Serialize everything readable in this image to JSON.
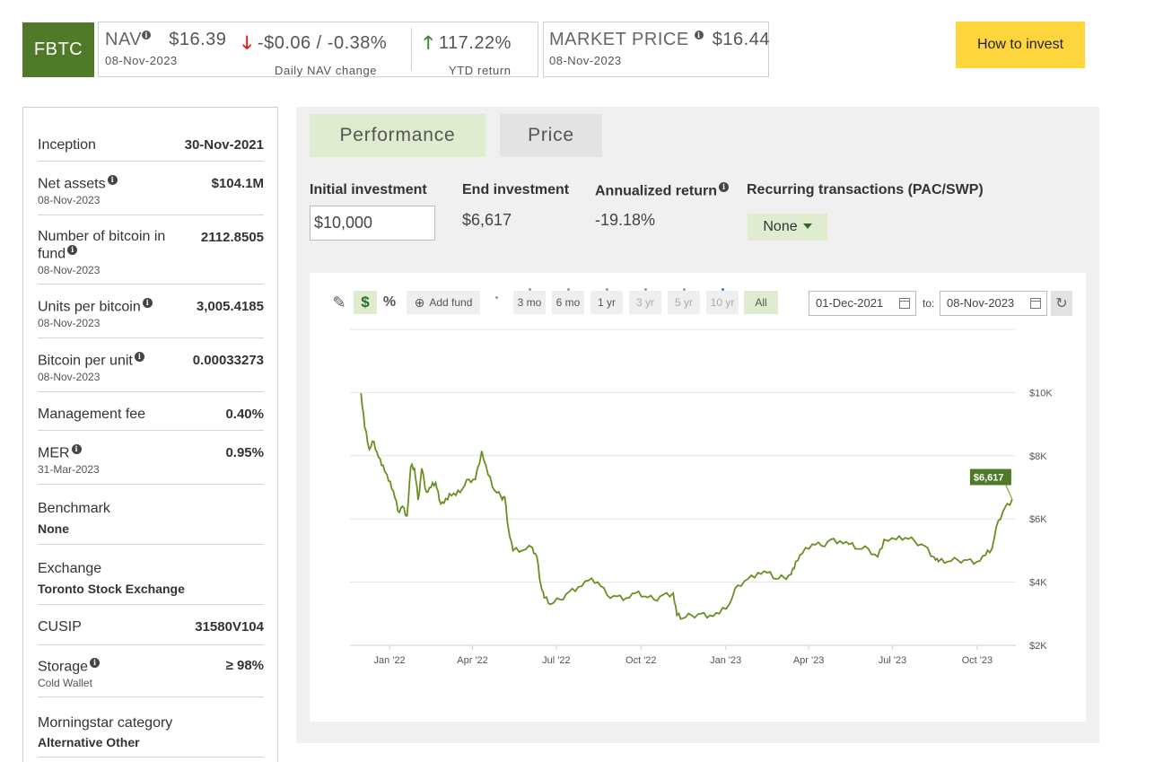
{
  "header": {
    "ticker": "FBTC",
    "nav_label": "NAV",
    "nav_value": "$16.39",
    "nav_date": "08-Nov-2023",
    "daily_change": "-$0.06 / -0.38%",
    "daily_change_label": "Daily NAV change",
    "ytd_return": "117.22%",
    "ytd_label": "YTD return",
    "market_price_label": "MARKET PRICE",
    "market_price_value": "$16.44",
    "market_price_date": "08-Nov-2023",
    "invest_button": "How to invest",
    "arrow_down": "🡓",
    "arrow_up": "🡑",
    "info_glyph": "i"
  },
  "facts": [
    {
      "label": "Inception",
      "value": "30-Nov-2021"
    },
    {
      "label": "Net assets",
      "value": "$104.1M",
      "sub": "08-Nov-2023"
    },
    {
      "label": "Number of bitcoin in fund",
      "value": "2112.8505",
      "sub": "08-Nov-2023"
    },
    {
      "label": "Units per bitcoin",
      "value": "3,005.4185",
      "sub": "08-Nov-2023"
    },
    {
      "label": "Bitcoin per unit",
      "value": "0.00033273",
      "sub": "08-Nov-2023"
    },
    {
      "label": "Management fee",
      "value": "0.40%"
    },
    {
      "label": "MER",
      "value": "0.95%",
      "sub": "31-Mar-2023"
    },
    {
      "label": "Benchmark",
      "subbold": "None"
    },
    {
      "label": "Exchange",
      "subbold": "Toronto Stock Exchange"
    },
    {
      "label": "CUSIP",
      "value": "31580V104"
    },
    {
      "label": "Storage",
      "value": "≥ 98%",
      "sub": "Cold Wallet"
    },
    {
      "label": "Morningstar category",
      "subbold": "Alternative Other"
    }
  ],
  "performance": {
    "tabs": [
      "Performance",
      "Price"
    ],
    "initial_investment_label": "Initial investment",
    "initial_investment_value": "$10,000",
    "end_investment_label": "End investment",
    "end_investment_value": "$6,617",
    "annualized_return_label": "Annualized return",
    "annualized_return_value": "-19.18%",
    "recurring_label": "Recurring transactions (PAC/SWP)",
    "recurring_value": "None",
    "toolbar": {
      "pencil_icon": "✎",
      "dollar": "$",
      "percent": "%",
      "add_fund": "Add fund",
      "add_icon": "⊕",
      "ranges": [
        "3 mo",
        "6 mo",
        "1 yr",
        "3 yr",
        "5 yr",
        "10 yr",
        "All"
      ],
      "from_date": "01-Dec-2021",
      "to_label": "to:",
      "to_date": "08-Nov-2023",
      "reset_icon": "↻"
    },
    "end_label": "$6,617"
  },
  "chart_data": {
    "type": "line",
    "title": "",
    "xlabel": "",
    "ylabel": "",
    "x_ticks": [
      "Jan '22",
      "Apr '22",
      "Jul '22",
      "Oct '22",
      "Jan '23",
      "Apr '23",
      "Jul '23",
      "Oct '23"
    ],
    "y_ticks": [
      "$2K",
      "$4K",
      "$6K",
      "$8K",
      "$10K"
    ],
    "ylim": [
      2000,
      12000
    ],
    "grid": true,
    "series": [
      {
        "color": "#6b8e23",
        "x": [
          "2021-12-01",
          "2021-12-05",
          "2021-12-10",
          "2021-12-15",
          "2021-12-20",
          "2021-12-25",
          "2021-12-31",
          "2022-01-05",
          "2022-01-10",
          "2022-01-15",
          "2022-01-20",
          "2022-01-24",
          "2022-01-28",
          "2022-02-01",
          "2022-02-05",
          "2022-02-10",
          "2022-02-15",
          "2022-02-20",
          "2022-02-24",
          "2022-03-01",
          "2022-03-07",
          "2022-03-14",
          "2022-03-21",
          "2022-03-28",
          "2022-04-04",
          "2022-04-11",
          "2022-04-18",
          "2022-04-25",
          "2022-05-02",
          "2022-05-06",
          "2022-05-10",
          "2022-05-15",
          "2022-05-25",
          "2022-06-05",
          "2022-06-10",
          "2022-06-14",
          "2022-06-18",
          "2022-06-25",
          "2022-07-05",
          "2022-07-15",
          "2022-07-25",
          "2022-08-05",
          "2022-08-15",
          "2022-08-25",
          "2022-09-05",
          "2022-09-15",
          "2022-09-25",
          "2022-10-05",
          "2022-10-15",
          "2022-10-25",
          "2022-11-05",
          "2022-11-09",
          "2022-11-15",
          "2022-11-25",
          "2022-12-05",
          "2022-12-15",
          "2022-12-25",
          "2023-01-05",
          "2023-01-14",
          "2023-01-25",
          "2023-02-05",
          "2023-02-15",
          "2023-02-25",
          "2023-03-05",
          "2023-03-13",
          "2023-03-18",
          "2023-03-25",
          "2023-04-05",
          "2023-04-15",
          "2023-04-25",
          "2023-05-05",
          "2023-05-15",
          "2023-05-25",
          "2023-06-05",
          "2023-06-15",
          "2023-06-22",
          "2023-07-05",
          "2023-07-15",
          "2023-07-25",
          "2023-08-05",
          "2023-08-15",
          "2023-08-20",
          "2023-08-30",
          "2023-09-10",
          "2023-09-20",
          "2023-10-01",
          "2023-10-10",
          "2023-10-17",
          "2023-10-24",
          "2023-10-31",
          "2023-11-08"
        ],
        "values": [
          9980,
          8900,
          8200,
          8450,
          7950,
          7700,
          7200,
          6900,
          6250,
          6400,
          6100,
          7650,
          7600,
          6600,
          7600,
          6850,
          7000,
          7150,
          6600,
          6500,
          6800,
          6750,
          6950,
          7250,
          7250,
          8150,
          7400,
          6900,
          6700,
          6700,
          5700,
          5000,
          5000,
          5100,
          4800,
          3950,
          3500,
          3300,
          3450,
          3700,
          3850,
          4050,
          4000,
          3600,
          3550,
          3500,
          3650,
          3550,
          3450,
          3600,
          3650,
          2950,
          2850,
          2950,
          3000,
          2950,
          3000,
          3300,
          3900,
          4100,
          4300,
          4300,
          4100,
          4150,
          4250,
          4650,
          4900,
          5200,
          5150,
          5350,
          5300,
          5200,
          5050,
          5050,
          4800,
          5350,
          5350,
          5400,
          5300,
          5150,
          4800,
          4650,
          4650,
          4700,
          4700,
          4650,
          4850,
          5050,
          5950,
          6350,
          6617
        ]
      }
    ],
    "annotations": [
      "$6,617"
    ]
  }
}
